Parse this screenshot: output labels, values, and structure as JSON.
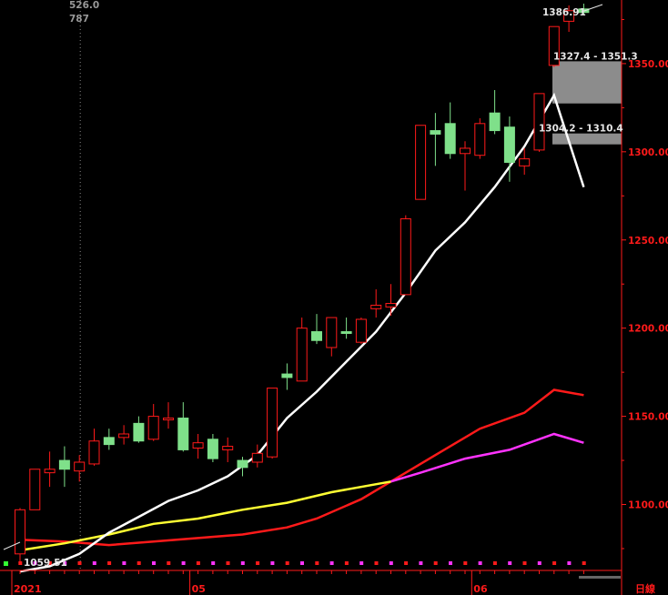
{
  "chart_data": {
    "type": "candlestick",
    "period_label": "日線",
    "colors": {
      "up": "#ff1a1a",
      "down": "#7fe08a",
      "axis": "#ff1a1a",
      "ma_short": "#ffffff",
      "ma_mid": "#ffff33",
      "ma_long": "#ff1a1a",
      "ma_extra": "#ff33ff",
      "zone": "#8c8c8c"
    },
    "y_ticks": [
      "1100.00",
      "1150.00",
      "1200.00",
      "1250.00",
      "1300.00",
      "1350.00"
    ],
    "x_ticks": [
      {
        "label": "2021",
        "index": 0
      },
      {
        "label": "05",
        "index": 12
      },
      {
        "label": "06",
        "index": 31
      }
    ],
    "ylim": [
      1058,
      1378
    ],
    "candles": [
      {
        "o": 1072,
        "h": 1098,
        "l": 1066,
        "c": 1097
      },
      {
        "o": 1097,
        "h": 1120,
        "l": 1097,
        "c": 1120
      },
      {
        "o": 1118,
        "h": 1130,
        "l": 1110,
        "c": 1120
      },
      {
        "o": 1125,
        "h": 1133,
        "l": 1110,
        "c": 1120
      },
      {
        "o": 1119,
        "h": 1128,
        "l": 1113,
        "c": 1124
      },
      {
        "o": 1123,
        "h": 1143,
        "l": 1122,
        "c": 1136
      },
      {
        "o": 1138,
        "h": 1143,
        "l": 1131,
        "c": 1134
      },
      {
        "o": 1138,
        "h": 1145,
        "l": 1134,
        "c": 1140
      },
      {
        "o": 1146,
        "h": 1150,
        "l": 1135,
        "c": 1136
      },
      {
        "o": 1137,
        "h": 1157,
        "l": 1136,
        "c": 1150
      },
      {
        "o": 1148,
        "h": 1158,
        "l": 1143,
        "c": 1149
      },
      {
        "o": 1149,
        "h": 1158,
        "l": 1130,
        "c": 1131
      },
      {
        "o": 1132,
        "h": 1140,
        "l": 1126,
        "c": 1135
      },
      {
        "o": 1137,
        "h": 1140,
        "l": 1124,
        "c": 1126
      },
      {
        "o": 1131,
        "h": 1138,
        "l": 1124,
        "c": 1133
      },
      {
        "o": 1125,
        "h": 1127,
        "l": 1116,
        "c": 1121
      },
      {
        "o": 1124,
        "h": 1134,
        "l": 1121,
        "c": 1129
      },
      {
        "o": 1127,
        "h": 1166,
        "l": 1126,
        "c": 1166
      },
      {
        "o": 1174,
        "h": 1180,
        "l": 1165,
        "c": 1172
      },
      {
        "o": 1170,
        "h": 1206,
        "l": 1170,
        "c": 1200
      },
      {
        "o": 1198,
        "h": 1208,
        "l": 1191,
        "c": 1193
      },
      {
        "o": 1189,
        "h": 1206,
        "l": 1184,
        "c": 1206
      },
      {
        "o": 1198,
        "h": 1206,
        "l": 1194,
        "c": 1197
      },
      {
        "o": 1192,
        "h": 1206,
        "l": 1191,
        "c": 1205
      },
      {
        "o": 1211,
        "h": 1222,
        "l": 1206,
        "c": 1213
      },
      {
        "o": 1212,
        "h": 1225,
        "l": 1207,
        "c": 1214
      },
      {
        "o": 1219,
        "h": 1264,
        "l": 1219,
        "c": 1262
      },
      {
        "o": 1273,
        "h": 1315,
        "l": 1273,
        "c": 1315
      },
      {
        "o": 1312,
        "h": 1322,
        "l": 1292,
        "c": 1310
      },
      {
        "o": 1316,
        "h": 1328,
        "l": 1296,
        "c": 1299
      },
      {
        "o": 1299,
        "h": 1306,
        "l": 1278,
        "c": 1302
      },
      {
        "o": 1298,
        "h": 1319,
        "l": 1296,
        "c": 1316
      },
      {
        "o": 1322,
        "h": 1335,
        "l": 1310,
        "c": 1312
      },
      {
        "o": 1314,
        "h": 1320,
        "l": 1283,
        "c": 1294
      },
      {
        "o": 1292,
        "h": 1302,
        "l": 1287,
        "c": 1296
      },
      {
        "o": 1301,
        "h": 1333,
        "l": 1300,
        "c": 1333
      },
      {
        "o": 1349,
        "h": 1371,
        "l": 1348,
        "c": 1371
      },
      {
        "o": 1374,
        "h": 1383,
        "l": 1368,
        "c": 1380
      },
      {
        "o": 1381,
        "h": 1384,
        "l": 1378,
        "c": 1379
      }
    ],
    "ma_short": [
      [
        0,
        1062
      ],
      [
        2,
        1065
      ],
      [
        4,
        1072
      ],
      [
        6,
        1084
      ],
      [
        8,
        1093
      ],
      [
        10,
        1102
      ],
      [
        12,
        1108
      ],
      [
        14,
        1116
      ],
      [
        16,
        1128
      ],
      [
        18,
        1149
      ],
      [
        20,
        1164
      ],
      [
        22,
        1181
      ],
      [
        24,
        1198
      ],
      [
        26,
        1220
      ],
      [
        28,
        1244
      ],
      [
        30,
        1260
      ],
      [
        32,
        1280
      ],
      [
        34,
        1303
      ],
      [
        36,
        1332
      ],
      [
        38,
        1280
      ]
    ],
    "ma_mid": [
      [
        0,
        1074
      ],
      [
        3,
        1078
      ],
      [
        6,
        1083
      ],
      [
        9,
        1089
      ],
      [
        12,
        1092
      ],
      [
        15,
        1097
      ],
      [
        18,
        1101
      ],
      [
        21,
        1107
      ],
      [
        25,
        1113
      ]
    ],
    "ma_long": [
      [
        0,
        1080
      ],
      [
        3,
        1079
      ],
      [
        6,
        1077
      ],
      [
        9,
        1079
      ],
      [
        12,
        1081
      ],
      [
        15,
        1083
      ],
      [
        18,
        1087
      ],
      [
        20,
        1092
      ],
      [
        23,
        1103
      ],
      [
        25,
        1113
      ],
      [
        28,
        1128
      ],
      [
        31,
        1143
      ],
      [
        34,
        1152
      ],
      [
        36,
        1165
      ],
      [
        38,
        1162
      ]
    ],
    "ma_extra": [
      [
        25,
        1113
      ],
      [
        27,
        1118
      ],
      [
        30,
        1126
      ],
      [
        33,
        1131
      ],
      [
        36,
        1140
      ],
      [
        38,
        1135
      ]
    ],
    "zones": [
      {
        "label": "1327.4 - 1351.3",
        "low": 1327.4,
        "high": 1351.3
      },
      {
        "label": "1304.2 - 1310.4",
        "low": 1304.2,
        "high": 1310.4
      }
    ],
    "annotations": {
      "high_label": "1386.91",
      "low_label": "1059.51",
      "crosshair_top": "526.0",
      "crosshair_sub": "787"
    },
    "crosshair_index": 4
  }
}
